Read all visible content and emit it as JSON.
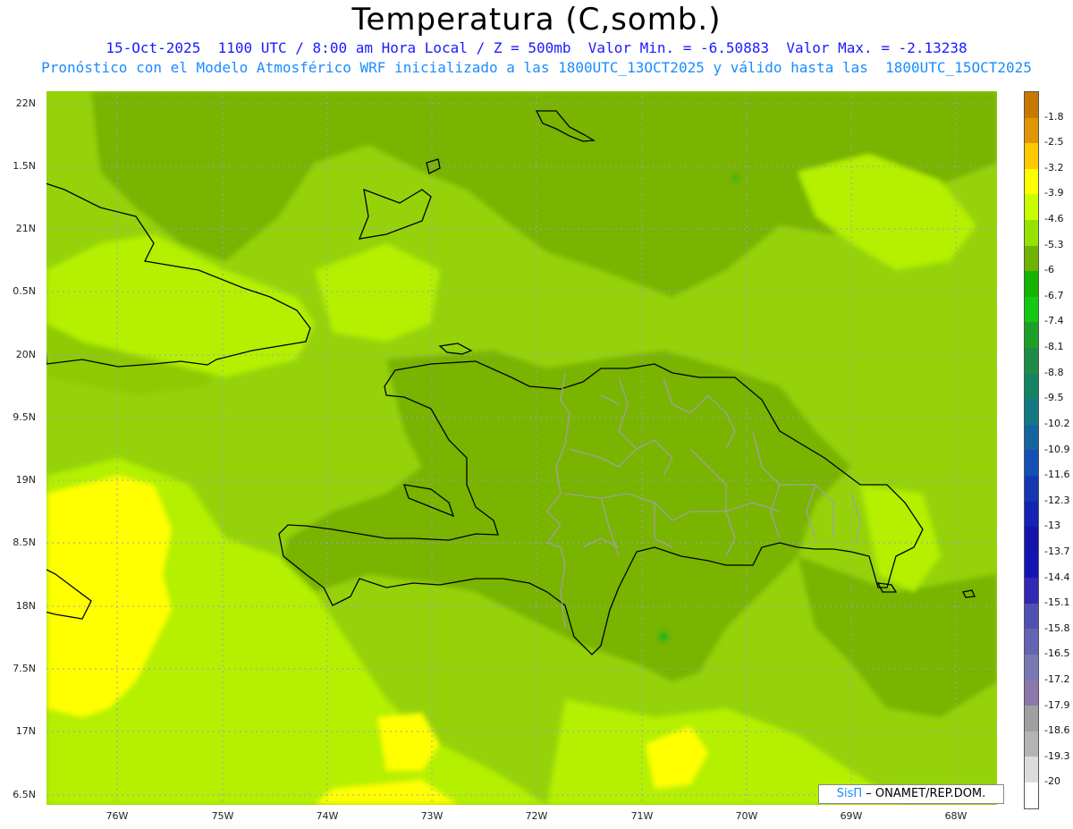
{
  "title": "Temperatura (C,somb.)",
  "subtitle_line1": "15-Oct-2025  1100 UTC / 8:00 am Hora Local / Z = 500mb  Valor Min. = -6.50883  Valor Max. = -2.13238",
  "subtitle_line2": "Pronóstico con el Modelo Atmosférico WRF inicializado a las 1800UTC_13OCT2025 y válido hasta las  1800UTC_15OCT2025",
  "lat_labels": [
    "22N",
    "1.5N",
    "21N",
    "0.5N",
    "20N",
    "9.5N",
    "19N",
    "8.5N",
    "18N",
    "7.5N",
    "17N",
    "6.5N"
  ],
  "lon_labels": [
    "76W",
    "75W",
    "74W",
    "73W",
    "72W",
    "71W",
    "70W",
    "69W",
    "68W"
  ],
  "colorbar": {
    "labels": [
      "-1.8",
      "-2.5",
      "-3.2",
      "-3.9",
      "-4.6",
      "-5.3",
      "-6",
      "-6.7",
      "-7.4",
      "-8.1",
      "-8.8",
      "-9.5",
      "-10.2",
      "-10.9",
      "-11.6",
      "-12.3",
      "-13",
      "-13.7",
      "-14.4",
      "-15.1",
      "-15.8",
      "-16.5",
      "-17.2",
      "-17.9",
      "-18.6",
      "-19.3",
      "-20"
    ],
    "colors": [
      "#c87800",
      "#e09600",
      "#ffc800",
      "#ffff00",
      "#c8ff00",
      "#96e100",
      "#6eb400",
      "#14b400",
      "#14c814",
      "#1ea028",
      "#1e8c46",
      "#148264",
      "#147882",
      "#1464a0",
      "#1450b4",
      "#1437b4",
      "#1423b4",
      "#1414aa",
      "#1414b4",
      "#3228b4",
      "#5050b4",
      "#6464b4",
      "#7878b4",
      "#8c78aa",
      "#a0a0a0",
      "#b4b4b4",
      "#dcdcdc",
      "#ffffff"
    ]
  },
  "map_colors": {
    "base": "#96d20a",
    "light": "#b4f000",
    "dark": "#78b400",
    "yellow": "#ffff00",
    "gold": "#ffd200",
    "green": "#14b414"
  },
  "credit": {
    "logo": "SisΠ",
    "text": "– ONAMET/REP.DOM."
  }
}
